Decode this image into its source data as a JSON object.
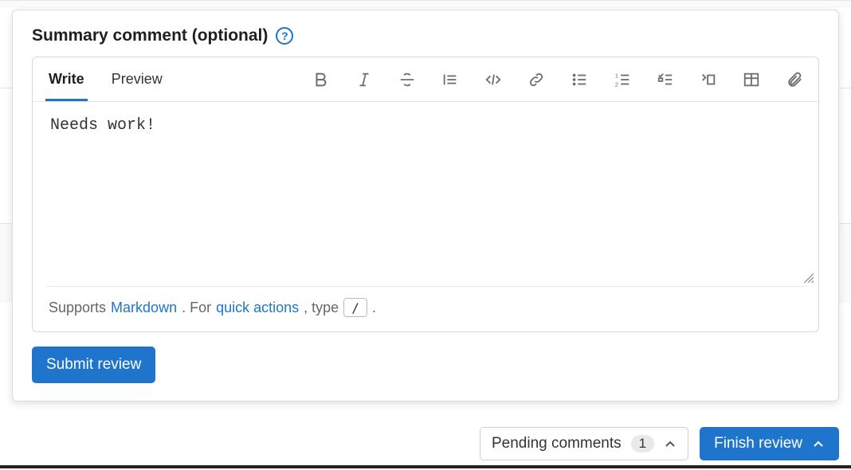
{
  "panel": {
    "title": "Summary comment (optional)"
  },
  "tabs": {
    "write": "Write",
    "preview": "Preview"
  },
  "toolbar_icons": {
    "bold": "bold-icon",
    "italic": "italic-icon",
    "strike": "strike-icon",
    "quote": "quote-icon",
    "code": "code-icon",
    "link": "link-icon",
    "ul": "bulleted-list-icon",
    "ol": "numbered-list-icon",
    "task": "task-list-icon",
    "collapse": "collapse-section-icon",
    "table": "table-icon",
    "attach": "attach-file-icon"
  },
  "editor": {
    "value": "Needs work!"
  },
  "footer": {
    "supports": "Supports ",
    "markdown": "Markdown",
    "for": ". For ",
    "quick_actions": "quick actions",
    "type": ", type ",
    "key": "/",
    "period": "."
  },
  "buttons": {
    "submit": "Submit review",
    "pending": "Pending comments",
    "pending_count": "1",
    "finish": "Finish review"
  }
}
